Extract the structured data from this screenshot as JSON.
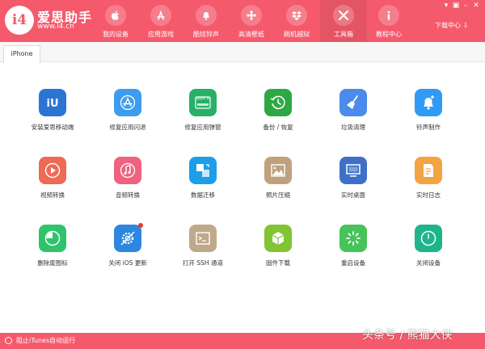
{
  "brand": {
    "logo_text": "i4",
    "name": "爱思助手",
    "url": "www.i4.cn"
  },
  "nav": [
    {
      "label": "我的设备",
      "icon": "apple-icon"
    },
    {
      "label": "应用游戏",
      "icon": "app-store-icon"
    },
    {
      "label": "酷炫铃声",
      "icon": "bell-icon"
    },
    {
      "label": "高清壁纸",
      "icon": "wallpaper-icon"
    },
    {
      "label": "刷机越狱",
      "icon": "dropbox-icon"
    },
    {
      "label": "工具箱",
      "icon": "tools-icon"
    },
    {
      "label": "教程中心",
      "icon": "info-icon"
    }
  ],
  "window": {
    "download_center": "下载中心"
  },
  "tab": {
    "label": "iPhone"
  },
  "tiles": [
    {
      "label": "安装爱思移动端",
      "color": "#2b74d4"
    },
    {
      "label": "修复应用闪退",
      "color": "#3d9cf0"
    },
    {
      "label": "修复应用弹窗",
      "color": "#27b066",
      "icon_text": "Apple ID"
    },
    {
      "label": "备份 / 恢复",
      "color": "#2ea844"
    },
    {
      "label": "垃圾清理",
      "color": "#4a8bec"
    },
    {
      "label": "铃声制作",
      "color": "#2f9bf4"
    },
    {
      "label": "视频转换",
      "color": "#ee6a55"
    },
    {
      "label": "音频转换",
      "color": "#f0627d"
    },
    {
      "label": "数据迁移",
      "color": "#1d9ee9"
    },
    {
      "label": "照片压缩",
      "color": "#bfa17e"
    },
    {
      "label": "实时桌面",
      "color": "#3e70c7"
    },
    {
      "label": "实时日志",
      "color": "#f2a342"
    },
    {
      "label": "删除废图标",
      "color": "#2fc46c"
    },
    {
      "label": "关闭 iOS 更新",
      "color": "#2d86e0",
      "badge": true
    },
    {
      "label": "打开 SSH 通道",
      "color": "#c0a98a"
    },
    {
      "label": "固件下载",
      "color": "#82c434"
    },
    {
      "label": "重启设备",
      "color": "#47c35a"
    },
    {
      "label": "关闭设备",
      "color": "#1fb58a"
    }
  ],
  "footer": {
    "label": "阻止iTunes自动运行"
  },
  "watermark": "头条号 / 熊猫大侠",
  "colors": {
    "accent": "#f45a6c"
  }
}
